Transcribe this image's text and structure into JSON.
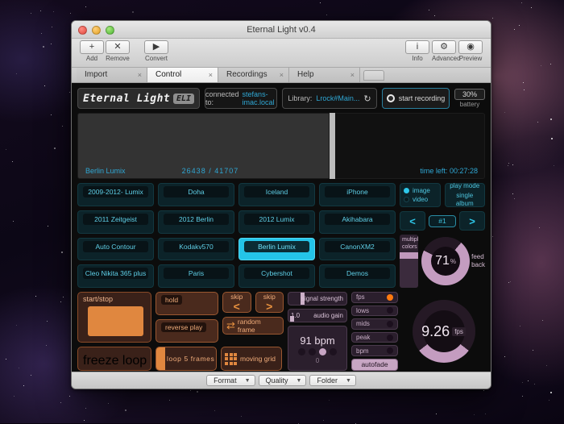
{
  "window": {
    "title": "Eternal Light v0.4",
    "controls": {
      "close": "close",
      "minimize": "minimize",
      "maximize": "maximize"
    }
  },
  "toolbar": {
    "left": [
      {
        "name": "add",
        "glyph": "+",
        "label": "Add"
      },
      {
        "name": "remove",
        "glyph": "✕",
        "label": "Remove"
      },
      {
        "name": "convert",
        "glyph": "▶",
        "label": "Convert"
      }
    ],
    "right": [
      {
        "name": "info",
        "glyph": "i",
        "label": "Info"
      },
      {
        "name": "advanced",
        "glyph": "⚙",
        "label": "Advanced"
      },
      {
        "name": "preview",
        "glyph": "◉",
        "label": "Preview"
      }
    ]
  },
  "tabs": [
    {
      "label": "Import",
      "active": false,
      "close": "×"
    },
    {
      "label": "Control",
      "active": true,
      "close": "×"
    },
    {
      "label": "Recordings",
      "active": false,
      "close": "×"
    },
    {
      "label": "Help",
      "active": false,
      "close": "×"
    }
  ],
  "header": {
    "logo_text": "Eternal Light",
    "logo_badge": "ELI",
    "connected_label": "connected to:",
    "connected_host": "stefans-imac.local",
    "library_label": "Library:",
    "library_name": "Lrock#Main...",
    "refresh_icon": "↻",
    "record_label": "start recording",
    "battery_percent": "30%",
    "battery_label": "battery"
  },
  "monitor": {
    "clip_name": "Berlin Lumix",
    "frame_current": "26438",
    "frame_sep": "/",
    "frame_total": "41707",
    "time_left_label": "time left:",
    "time_left_value": "00:27:28"
  },
  "presets": [
    {
      "label": "2009-2012- Lumix",
      "selected": false
    },
    {
      "label": "Doha",
      "selected": false
    },
    {
      "label": "Iceland",
      "selected": false
    },
    {
      "label": "iPhone",
      "selected": false
    },
    {
      "label": "2011 Zeitgeist",
      "selected": false
    },
    {
      "label": "2012 Berlin",
      "selected": false
    },
    {
      "label": "2012 Lumix",
      "selected": false
    },
    {
      "label": "Akihabara",
      "selected": false
    },
    {
      "label": "Auto Contour",
      "selected": false
    },
    {
      "label": "Kodakv570",
      "selected": false
    },
    {
      "label": "Berlin Lumix",
      "selected": true
    },
    {
      "label": "CanonXM2",
      "selected": false
    },
    {
      "label": "Cleo Nikita 365 plus",
      "selected": false
    },
    {
      "label": "Paris",
      "selected": false
    },
    {
      "label": "Cybershot",
      "selected": false
    },
    {
      "label": "Demos",
      "selected": false
    }
  ],
  "media_mode": {
    "image_label": "image",
    "video_label": "video",
    "selected": "image"
  },
  "play_mode": {
    "title": "play mode",
    "value": "single album"
  },
  "album_nav": {
    "prev": "<",
    "next": ">",
    "index": "#1"
  },
  "multiply_colors": {
    "line1": "multiply",
    "line2": "colors",
    "value": "45 %"
  },
  "feedback": {
    "value": "71",
    "unit": "%",
    "label_line1": "feed",
    "label_line2": "back"
  },
  "transport": {
    "start_stop": "start/stop",
    "hold": "hold",
    "reverse_play": "reverse play",
    "freeze_loop": "freeze loop",
    "skip_back": {
      "label": "skip",
      "arrow": "<"
    },
    "skip_fwd": {
      "label": "skip",
      "arrow": ">"
    },
    "random_frame": {
      "label": "random frame",
      "icon": "⇄"
    },
    "loop": {
      "prefix": "loop",
      "count": "5",
      "suffix": "frames"
    },
    "moving_grid": "moving grid"
  },
  "audio": {
    "signal_strength_label": "signal strength",
    "audio_gain_label": "audio gain",
    "audio_gain_value": "1.0",
    "bpm_value": "91 bpm",
    "bpm_counter": "0",
    "beat_active_index": 2
  },
  "meters": [
    {
      "label": "fps",
      "hot": true
    },
    {
      "label": "lows",
      "hot": false
    },
    {
      "label": "mids",
      "hot": false
    },
    {
      "label": "peak",
      "hot": false
    },
    {
      "label": "bpm",
      "hot": false
    }
  ],
  "autofade": {
    "label": "autofade"
  },
  "fps_gauge": {
    "value": "9.26",
    "unit": "fps"
  },
  "statusbar": [
    {
      "label": "Format",
      "caret": "▼"
    },
    {
      "label": "Quality",
      "caret": "▼"
    },
    {
      "label": "Folder",
      "caret": "▼"
    }
  ]
}
